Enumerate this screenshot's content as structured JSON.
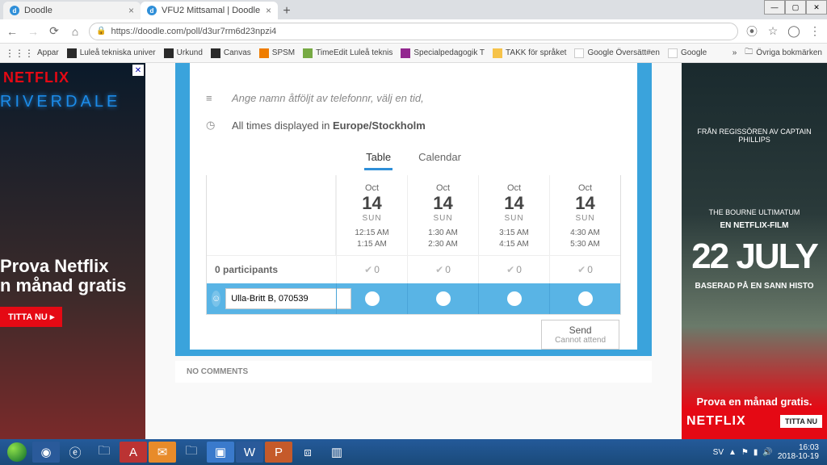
{
  "window": {
    "min": "—",
    "max": "▢",
    "close": "✕"
  },
  "tabs": [
    {
      "title": "Doodle"
    },
    {
      "title": "VFU2 Mittsamal | Doodle"
    }
  ],
  "nav": {
    "back": "←",
    "fwd": "→",
    "reload": "⟳",
    "home": "⌂"
  },
  "url": "https://doodle.com/poll/d3ur7rm6d23npzi4",
  "url_icons": {
    "translate": "⦿",
    "star": "☆",
    "profile": "◯",
    "menu": "⋮"
  },
  "bookmarks": {
    "apps": "Appar",
    "items": [
      "Luleå tekniska univer",
      "Urkund",
      "Canvas",
      "SPSM",
      "TimeEdit Luleå teknis",
      "Specialpedagogik T",
      "TAKK för språket",
      "Google Översätt#en",
      "Google"
    ],
    "overflow": "»",
    "other": "Övriga bokmärken"
  },
  "ad_left": {
    "logo": "NETFLIX",
    "show": "RIVERDALE",
    "headline1": "Prova Netflix",
    "headline2": "n månad gratis",
    "cta": "TITTA NU  ▸"
  },
  "ad_right": {
    "line1": "FRÅN REGISSÖREN AV CAPTAIN PHILLIPS",
    "line2": "THE BOURNE ULTIMATUM",
    "film": "EN NETFLIX-FILM",
    "big": "22 JULY",
    "based": "BASERAD PÅ EN SANN HISTO",
    "prova": "Prova en månad gratis.",
    "logo": "NETFLIX",
    "cta": "TITTA NU"
  },
  "poll": {
    "description": "Ange namn åtföljt av telefonnr, välj en tid,",
    "tz_prefix": "All times displayed in ",
    "tz": "Europe/Stockholm",
    "tab_table": "Table",
    "tab_calendar": "Calendar",
    "slots": [
      {
        "mon": "Oct",
        "day": "14",
        "dow": "SUN",
        "t1": "12:15 AM",
        "t2": "1:15 AM"
      },
      {
        "mon": "Oct",
        "day": "14",
        "dow": "SUN",
        "t1": "1:30 AM",
        "t2": "2:30 AM"
      },
      {
        "mon": "Oct",
        "day": "14",
        "dow": "SUN",
        "t1": "3:15 AM",
        "t2": "4:15 AM"
      },
      {
        "mon": "Oct",
        "day": "14",
        "dow": "SUN",
        "t1": "4:30 AM",
        "t2": "5:30 AM"
      }
    ],
    "participants_label": "0 participants",
    "vote_count": "0",
    "name_value": "Ulla-Britt B, 070539",
    "send": "Send",
    "cannot": "Cannot attend",
    "comments": "NO COMMENTS"
  },
  "taskbar": {
    "lang": "SV",
    "time": "16:03",
    "date": "2018-10-19"
  }
}
